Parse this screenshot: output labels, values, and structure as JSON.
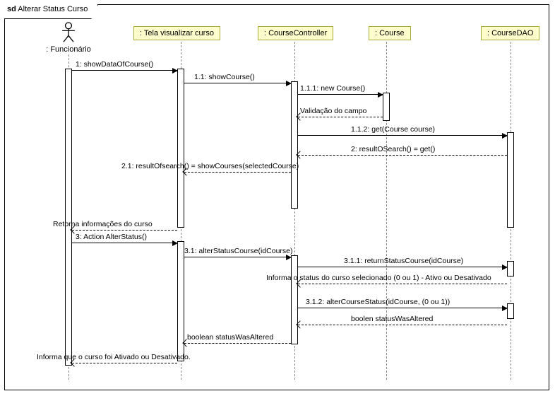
{
  "frame": {
    "prefix": "sd",
    "title": "Alterar Status Curso"
  },
  "actors": {
    "funcionario": ": Funcionário"
  },
  "lifelines": {
    "tela": ": Tela visualizar curso",
    "controller": ": CourseController",
    "course": ": Course",
    "dao": ": CourseDAO"
  },
  "messages": {
    "m1": "1: showDataOfCourse()",
    "m1_1": "1.1: showCourse()",
    "m1_1_1": "1.1.1: new Course()",
    "validacao": "Validação do campo",
    "m1_1_2": "1.1.2: get(Course course)",
    "m2": "2: resultOSearch() = get()",
    "m2_1": "2.1: resultOfsearch() = showCourses(selectedCourse)",
    "ret_info": "Retorna informações do curso",
    "m3": "3: Action AlterStatus()",
    "m3_1": "3.1: alterStatusCourse(idCourse)",
    "m3_1_1": "3.1.1: returnStatusCourse(idCourse)",
    "informa_status": "Informa o status do curso selecionado (0 ou 1) - Ativo ou Desativado",
    "m3_1_2": "3.1.2: alterCourseStatus(idCourse, (0 ou  1))",
    "boolen": "boolen statusWasAltered",
    "boolean": "boolean statusWasAltered",
    "informa_final": "Informa que o curso foi Ativado ou Desativado."
  },
  "chart_data": {
    "type": "sequence-diagram",
    "frame": "sd Alterar Status Curso",
    "participants": [
      {
        "id": "Funcionario",
        "label": ": Funcionário",
        "kind": "actor"
      },
      {
        "id": "Tela",
        "label": ": Tela visualizar curso",
        "kind": "object"
      },
      {
        "id": "CourseController",
        "label": ": CourseController",
        "kind": "object"
      },
      {
        "id": "Course",
        "label": ": Course",
        "kind": "object"
      },
      {
        "id": "CourseDAO",
        "label": ": CourseDAO",
        "kind": "object"
      }
    ],
    "interactions": [
      {
        "from": "Funcionario",
        "to": "Tela",
        "label": "1: showDataOfCourse()",
        "type": "call"
      },
      {
        "from": "Tela",
        "to": "CourseController",
        "label": "1.1: showCourse()",
        "type": "call"
      },
      {
        "from": "CourseController",
        "to": "Course",
        "label": "1.1.1: new Course()",
        "type": "create"
      },
      {
        "from": "Course",
        "to": "CourseController",
        "label": "Validação do campo",
        "type": "return"
      },
      {
        "from": "CourseController",
        "to": "CourseDAO",
        "label": "1.1.2: get(Course course)",
        "type": "call"
      },
      {
        "from": "CourseDAO",
        "to": "CourseController",
        "label": "2: resultOSearch() = get()",
        "type": "return"
      },
      {
        "from": "CourseController",
        "to": "Tela",
        "label": "2.1: resultOfsearch() = showCourses(selectedCourse)",
        "type": "return"
      },
      {
        "from": "Tela",
        "to": "Funcionario",
        "label": "Retorna informações do curso",
        "type": "return"
      },
      {
        "from": "Funcionario",
        "to": "Tela",
        "label": "3: Action AlterStatus()",
        "type": "call"
      },
      {
        "from": "Tela",
        "to": "CourseController",
        "label": "3.1: alterStatusCourse(idCourse)",
        "type": "call"
      },
      {
        "from": "CourseController",
        "to": "CourseDAO",
        "label": "3.1.1: returnStatusCourse(idCourse)",
        "type": "call"
      },
      {
        "from": "CourseDAO",
        "to": "CourseController",
        "label": "Informa o status do curso selecionado (0 ou 1) - Ativo ou Desativado",
        "type": "return"
      },
      {
        "from": "CourseController",
        "to": "CourseDAO",
        "label": "3.1.2: alterCourseStatus(idCourse, (0 ou  1))",
        "type": "call"
      },
      {
        "from": "CourseDAO",
        "to": "CourseController",
        "label": "boolen statusWasAltered",
        "type": "return"
      },
      {
        "from": "CourseController",
        "to": "Tela",
        "label": "boolean statusWasAltered",
        "type": "return"
      },
      {
        "from": "Tela",
        "to": "Funcionario",
        "label": "Informa que o curso foi Ativado ou Desativado.",
        "type": "return"
      }
    ]
  }
}
